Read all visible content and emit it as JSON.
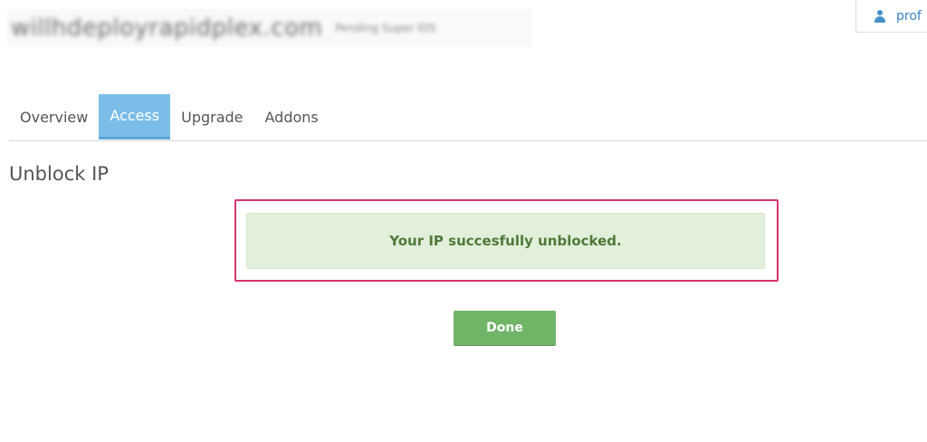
{
  "header": {
    "site_domain": "willhdeployrapidplex.com",
    "site_status": "Pending Super IDS",
    "profile_label": "prof",
    "profile_icon": "user-icon"
  },
  "tabs": [
    {
      "label": "Overview",
      "active": false
    },
    {
      "label": "Access",
      "active": true
    },
    {
      "label": "Upgrade",
      "active": false
    },
    {
      "label": "Addons",
      "active": false
    }
  ],
  "main": {
    "section_title": "Unblock IP",
    "alert_message": "Your IP succesfully unblocked.",
    "done_label": "Done"
  },
  "colors": {
    "active_tab": "#7bbde9",
    "alert_background": "#e2efda",
    "alert_text": "#4f7a3a",
    "done_button": "#70b468",
    "highlight_frame": "#d6336c",
    "profile_accent": "#3a83c2"
  }
}
